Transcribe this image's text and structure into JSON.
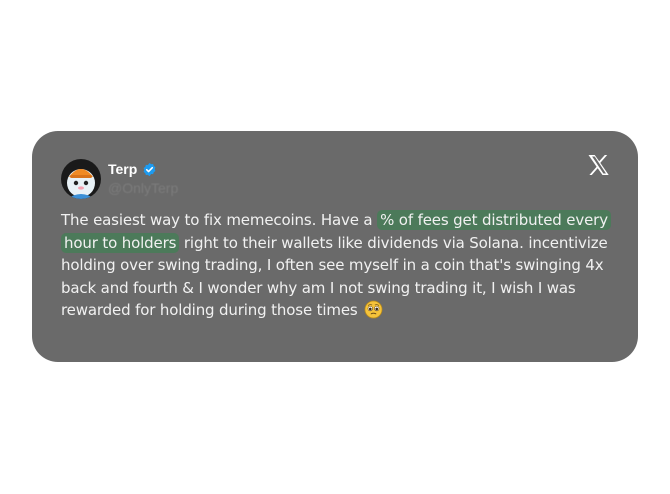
{
  "tweet": {
    "author_name": "Terp",
    "author_handle": "@OnlyTerp",
    "verified_icon": "verified-badge-icon",
    "platform_icon": "x-logo-icon",
    "text_before": "The easiest way to fix memecoins. Have a ",
    "highlighted_text": "% of fees get distributed every hour to holders",
    "text_after": " right to their wallets like dividends via Solana. incentivize holding over swing trading, I often see myself in a coin that's swinging 4x back and fourth & I wonder why am I not swing trading it, I wish I was rewarded for holding during those times",
    "emoji": "pleading-face-emoji"
  },
  "colors": {
    "card_background": "#6a6a6a",
    "highlight": "#4c7a5a",
    "verified_blue": "#1d9bf0",
    "text": "#f1f1f1"
  }
}
